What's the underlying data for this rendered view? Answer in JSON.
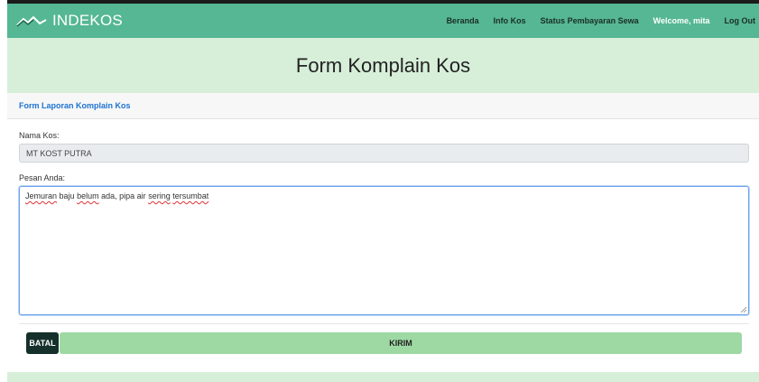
{
  "navbar": {
    "brand": "INDEKOS",
    "links": [
      {
        "label": "Beranda"
      },
      {
        "label": "Info Kos"
      },
      {
        "label": "Status Pembayaran Sewa"
      },
      {
        "label": "Welcome, mita"
      },
      {
        "label": "Log Out"
      }
    ]
  },
  "hero": {
    "title": "Form Komplain Kos"
  },
  "card": {
    "header": "Form Laporan Komplain Kos"
  },
  "form": {
    "nama_kos_label": "Nama Kos:",
    "nama_kos_value": "MT KOST PUTRA",
    "pesan_label": "Pesan Anda:",
    "pesan_words": [
      "Jemuran",
      "baju",
      "belum",
      "ada,",
      "pipa",
      "air",
      "sering",
      "tersumbat"
    ],
    "batal_label": "BATAL",
    "kirim_label": "KIRIM"
  },
  "colors": {
    "navbar": "#55b794",
    "hero": "#d7efd9",
    "link_blue": "#1e73d2",
    "batal": "#15302a",
    "kirim": "#9ed9a3"
  }
}
